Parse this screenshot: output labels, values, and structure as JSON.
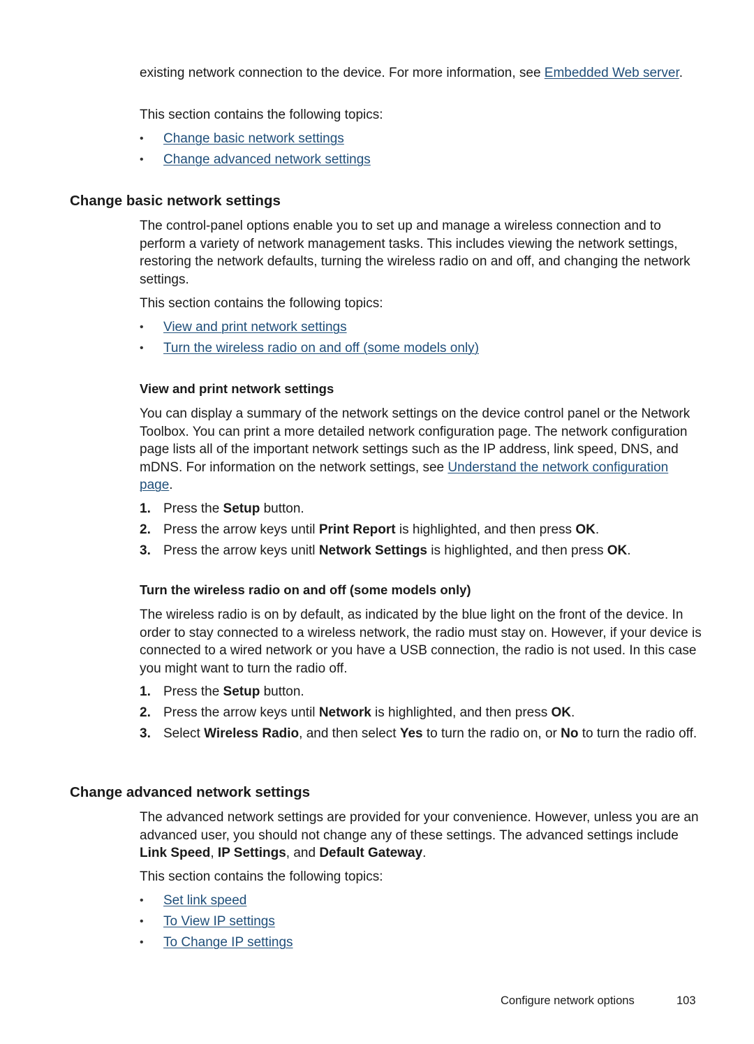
{
  "intro": {
    "text_before_link": "existing network connection to the device. For more information, see ",
    "link": "Embedded Web server",
    "text_after_link": ".",
    "topics_label": "This section contains the following topics:",
    "topics": [
      "Change basic network settings",
      "Change advanced network settings"
    ]
  },
  "basic": {
    "heading": "Change basic network settings",
    "paragraph": "The control-panel options enable you to set up and manage a wireless connection and to perform a variety of network management tasks. This includes viewing the network settings, restoring the network defaults, turning the wireless radio on and off, and changing the network settings.",
    "topics_label": "This section contains the following topics:",
    "topics": [
      "View and print network settings",
      "Turn the wireless radio on and off (some models only)"
    ]
  },
  "view_print": {
    "heading": "View and print network settings",
    "paragraph_before_link": "You can display a summary of the network settings on the device control panel or the Network Toolbox. You can print a more detailed network configuration page. The network configuration page lists all of the important network settings such as the IP address, link speed, DNS, and mDNS. For information on the network settings, see ",
    "link": "Understand the network configuration page",
    "paragraph_after_link": ".",
    "steps": [
      {
        "num": "1.",
        "parts": [
          [
            "Press the ",
            false
          ],
          [
            "Setup",
            true
          ],
          [
            " button.",
            false
          ]
        ]
      },
      {
        "num": "2.",
        "parts": [
          [
            "Press the arrow keys until ",
            false
          ],
          [
            "Print Report",
            true
          ],
          [
            " is highlighted, and then press ",
            false
          ],
          [
            "OK",
            true
          ],
          [
            ".",
            false
          ]
        ]
      },
      {
        "num": "3.",
        "parts": [
          [
            "Press the arrow keys unitl ",
            false
          ],
          [
            "Network Settings",
            true
          ],
          [
            " is highlighted, and then press ",
            false
          ],
          [
            "OK",
            true
          ],
          [
            ".",
            false
          ]
        ]
      }
    ]
  },
  "wireless": {
    "heading": "Turn the wireless radio on and off (some models only)",
    "paragraph": "The wireless radio is on by default, as indicated by the blue light on the front of the device. In order to stay connected to a wireless network, the radio must stay on. However, if your device is connected to a wired network or you have a USB connection, the radio is not used. In this case you might want to turn the radio off.",
    "steps": [
      {
        "num": "1.",
        "parts": [
          [
            "Press the ",
            false
          ],
          [
            "Setup",
            true
          ],
          [
            " button.",
            false
          ]
        ]
      },
      {
        "num": "2.",
        "parts": [
          [
            "Press the arrow keys until ",
            false
          ],
          [
            "Network",
            true
          ],
          [
            " is highlighted, and then press ",
            false
          ],
          [
            "OK",
            true
          ],
          [
            ".",
            false
          ]
        ]
      },
      {
        "num": "3.",
        "parts": [
          [
            "Select ",
            false
          ],
          [
            "Wireless Radio",
            true
          ],
          [
            ", and then select ",
            false
          ],
          [
            "Yes",
            true
          ],
          [
            " to turn the radio on, or ",
            false
          ],
          [
            "No",
            true
          ],
          [
            " to turn the radio off.",
            false
          ]
        ]
      }
    ]
  },
  "advanced": {
    "heading": "Change advanced network settings",
    "paragraph_parts": [
      [
        "The advanced network settings are provided for your convenience. However, unless you are an advanced user, you should not change any of these settings. The advanced settings include ",
        false
      ],
      [
        "Link Speed",
        true
      ],
      [
        ", ",
        false
      ],
      [
        "IP Settings",
        true
      ],
      [
        ", and ",
        false
      ],
      [
        "Default Gateway",
        true
      ],
      [
        ".",
        false
      ]
    ],
    "topics_label": "This section contains the following topics:",
    "topics": [
      "Set link speed",
      "To View IP settings",
      "To Change IP settings"
    ]
  },
  "footer": {
    "section": "Configure network options",
    "page_number": "103"
  },
  "colors": {
    "link": "#1f4e79",
    "text": "#1a1a1a"
  },
  "bullet_glyph": "•"
}
